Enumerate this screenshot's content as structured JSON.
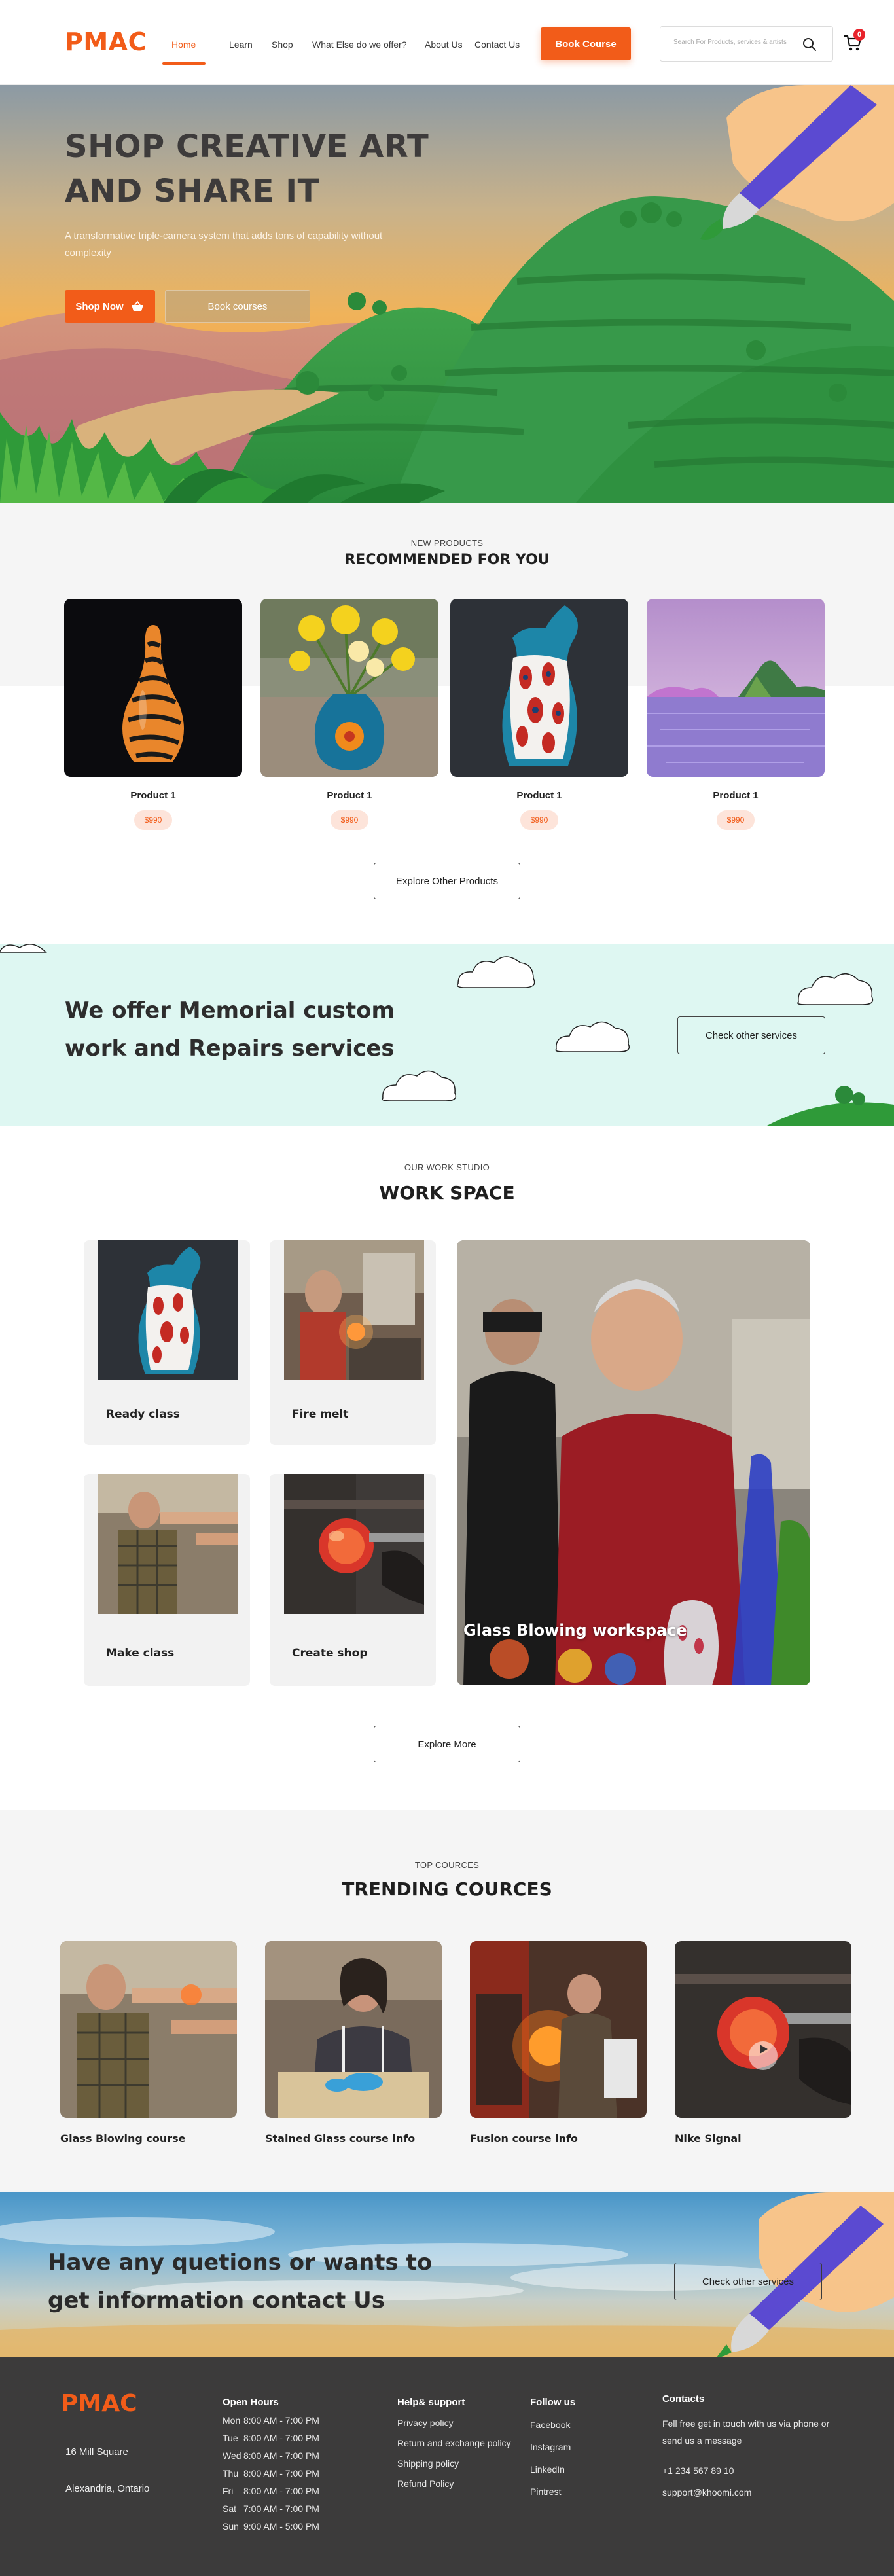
{
  "brand": {
    "logo": "PMAC",
    "accent": "#f25c19"
  },
  "nav": {
    "items": [
      {
        "label": "Home",
        "active": true
      },
      {
        "label": "Learn"
      },
      {
        "label": "Shop"
      },
      {
        "label": "What Else do we offer?"
      },
      {
        "label": "About Us"
      },
      {
        "label": "Contact Us"
      }
    ],
    "book_button": "Book Course",
    "search_placeholder": "Search For Products, services & artists",
    "cart_count": "0"
  },
  "hero": {
    "title": "SHOP CREATIVE ART AND SHARE IT",
    "subtitle": "A transformative triple-camera system that adds tons of capability without complexity",
    "shop_now": "Shop Now",
    "book_courses": "Book courses"
  },
  "products": {
    "eyebrow": "NEW PRODUCTS",
    "title": "RECOMMENDED FOR YOU",
    "items": [
      {
        "name": "Product 1",
        "price": "$990",
        "image": "striped-orange-vase"
      },
      {
        "name": "Product 1",
        "price": "$990",
        "image": "daffodils-in-vase"
      },
      {
        "name": "Product 1",
        "price": "$990",
        "image": "patterned-glass-vase"
      },
      {
        "name": "Product 1",
        "price": "$990",
        "image": "lake-landscape"
      }
    ],
    "explore_button": "Explore Other Products"
  },
  "memorial": {
    "text": "We offer Memorial custom work and Repairs services",
    "button": "Check other services"
  },
  "workspace": {
    "eyebrow": "OUR WORK STUDIO",
    "title": "WORK SPACE",
    "cards": [
      {
        "label": "Ready class"
      },
      {
        "label": "Fire melt"
      },
      {
        "label": "Make class"
      },
      {
        "label": "Create shop"
      }
    ],
    "feature_label": "Glass Blowing workspace",
    "explore_button": "Explore More"
  },
  "courses": {
    "eyebrow": "TOP COURCES",
    "title": "TRENDING COURCES",
    "items": [
      {
        "name": "Glass Blowing course"
      },
      {
        "name": "Stained Glass course info"
      },
      {
        "name": "Fusion course info"
      },
      {
        "name": "Nike Signal"
      }
    ]
  },
  "contact_banner": {
    "text": "Have any quetions  or  wants to get information contact  Us",
    "button": "Check other services"
  },
  "footer": {
    "logo": "PMAC",
    "address": [
      "16 Mill Square",
      "Alexandria, Ontario"
    ],
    "hours_title": "Open Hours",
    "hours": [
      {
        "day": "Mon",
        "time": "8:00 AM - 7:00 PM"
      },
      {
        "day": "Tue",
        "time": "8:00 AM - 7:00 PM"
      },
      {
        "day": "Wed",
        "time": "8:00 AM - 7:00 PM"
      },
      {
        "day": "Thu",
        "time": "8:00 AM - 7:00 PM"
      },
      {
        "day": "Fri",
        "time": "8:00 AM - 7:00 PM"
      },
      {
        "day": "Sat",
        "time": "7:00 AM - 7:00 PM"
      },
      {
        "day": "Sun",
        "time": "9:00 AM - 5:00 PM"
      }
    ],
    "help_title": "Help& support",
    "help_links": [
      "Privacy policy",
      "Return and exchange policy",
      "Shipping policy",
      "Refund Policy"
    ],
    "follow_title": "Follow us",
    "follow_links": [
      "Facebook",
      "Instagram",
      "LinkedIn",
      "Pintrest"
    ],
    "contacts_title": "Contacts",
    "contacts_text": "Fell free get in touch with us via phone or send us a message",
    "phone": "+1 234 567 89 10",
    "email": "support@khoomi.com"
  }
}
